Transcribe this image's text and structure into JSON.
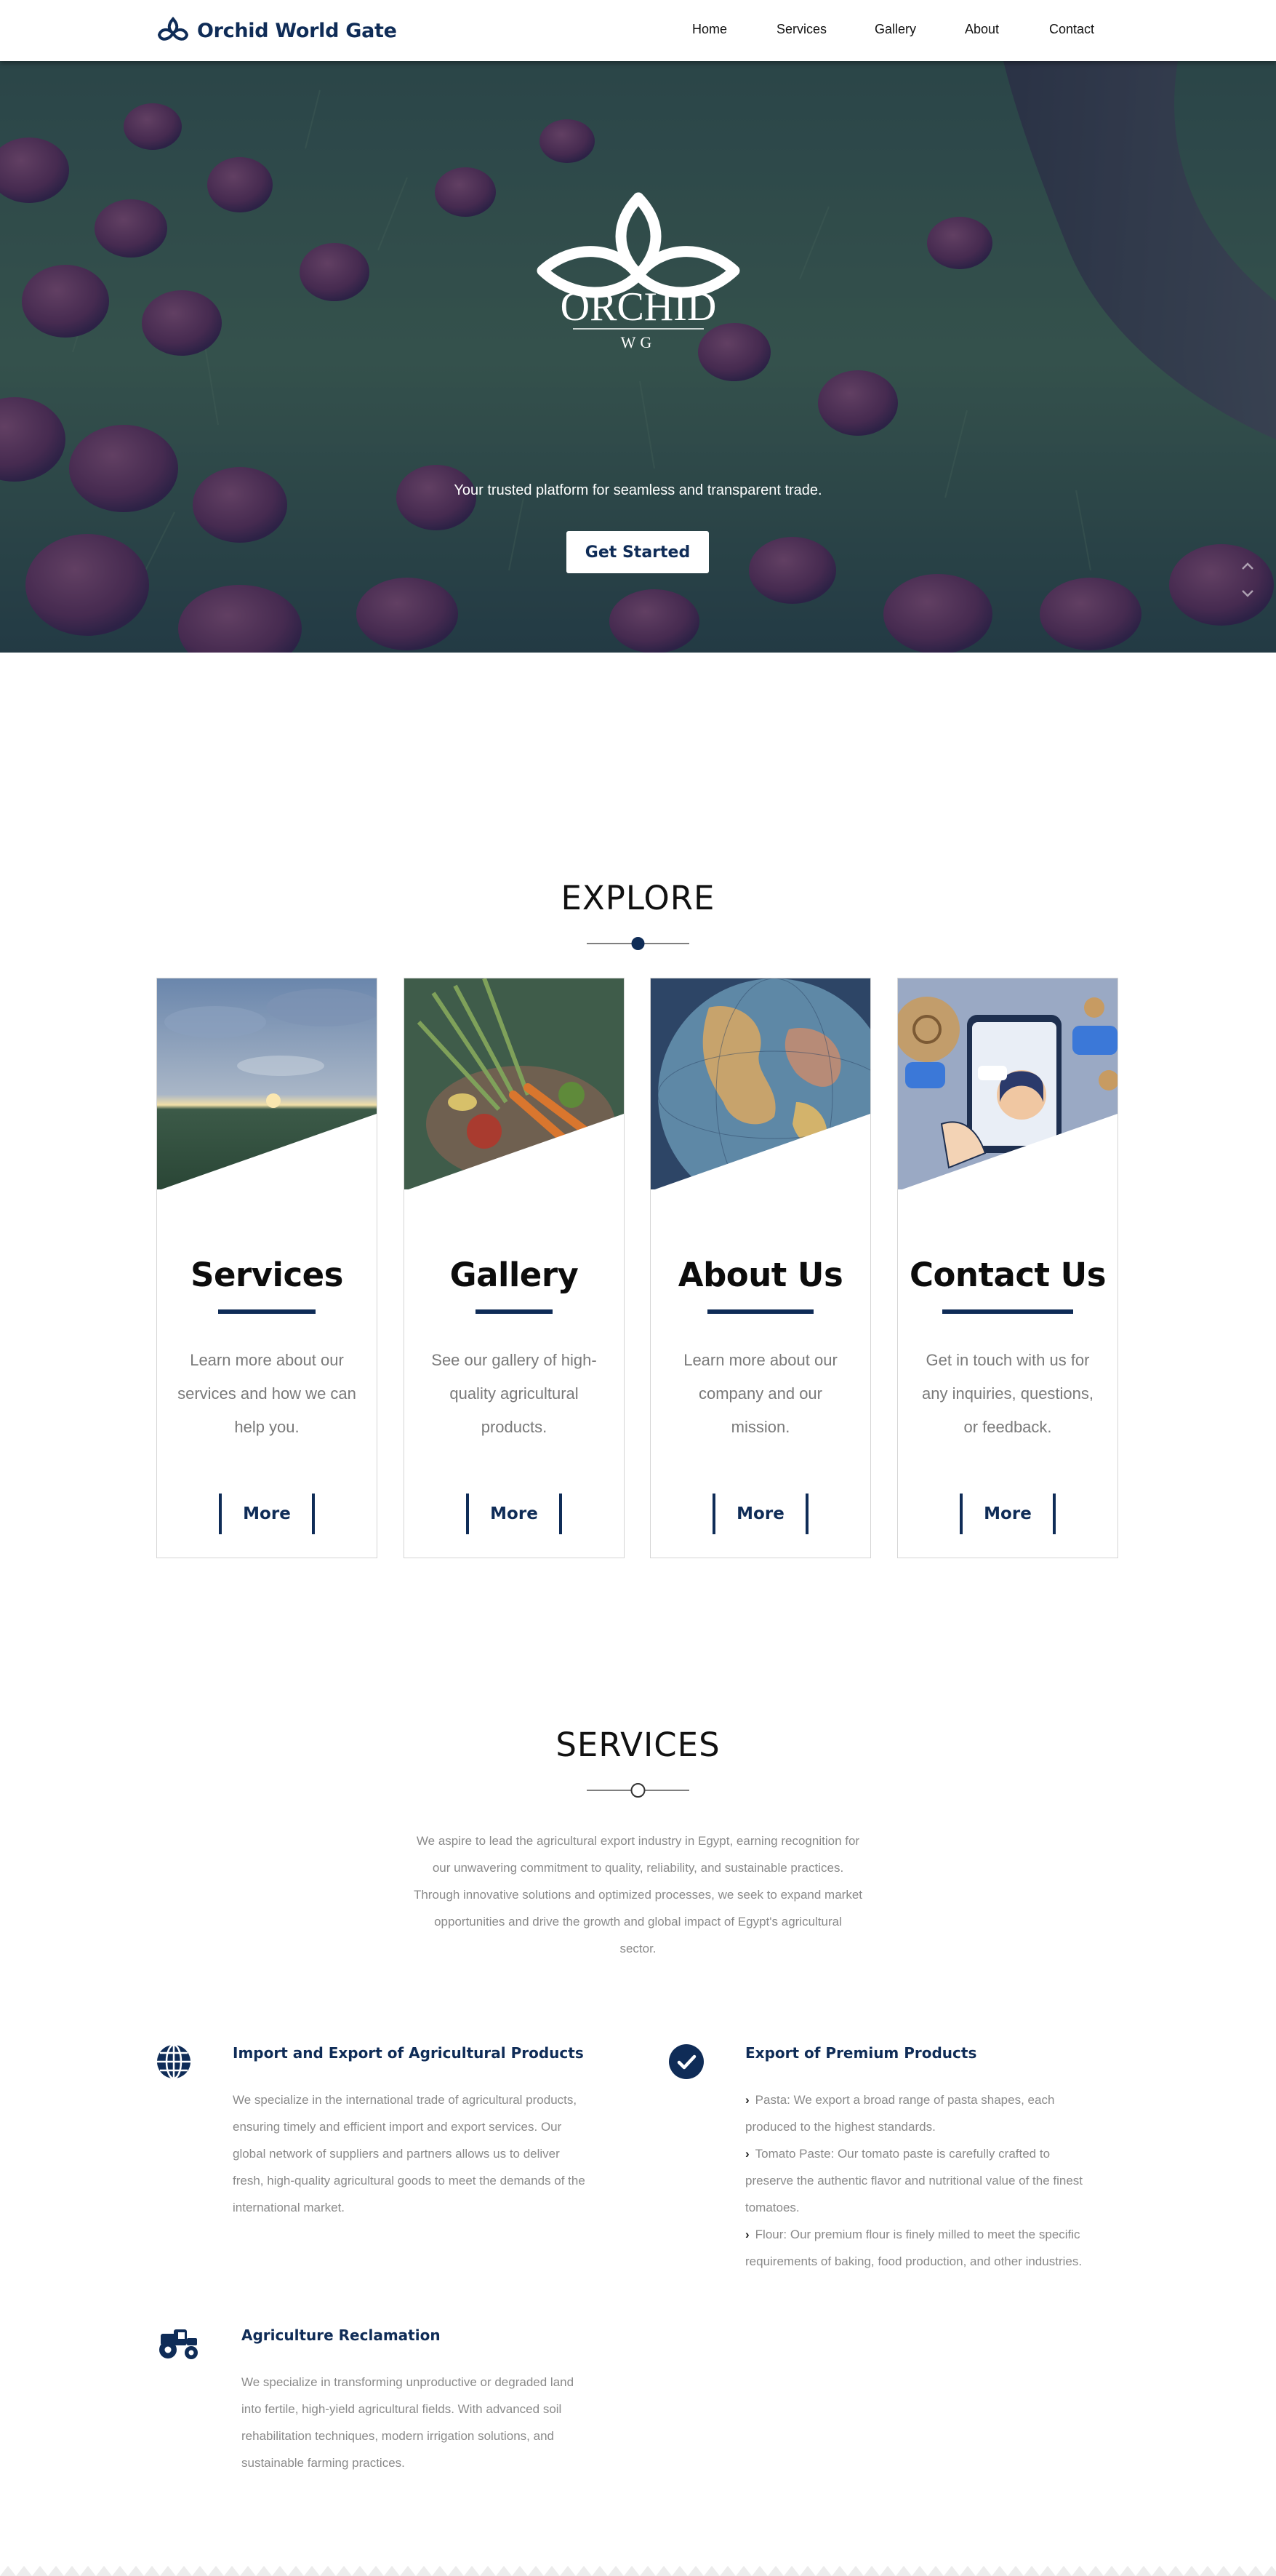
{
  "navbar": {
    "brand": "Orchid World Gate",
    "links": [
      "Home",
      "Services",
      "Gallery",
      "About",
      "Contact"
    ]
  },
  "hero": {
    "logo_word": "ORCHID",
    "logo_sub": "WG",
    "tagline": "Your trusted platform for seamless and transparent trade.",
    "cta": "Get Started",
    "scroll_up_icon": "chevron-up-icon",
    "scroll_down_icon": "chevron-down-icon"
  },
  "explore": {
    "title": "EXPLORE",
    "cards": [
      {
        "title": "Services",
        "desc_lines": [
          "Learn more about our",
          "services and how we can",
          "help you."
        ],
        "button": "More",
        "image": "wheat-field-sunset"
      },
      {
        "title": "Gallery",
        "desc_lines": [
          "See our gallery of high-",
          "quality agricultural",
          "products."
        ],
        "button": "More",
        "image": "vegetable-basket"
      },
      {
        "title": "About Us",
        "desc_lines": [
          "Learn more about our",
          "company and our",
          "mission."
        ],
        "button": "More",
        "image": "globe-map"
      },
      {
        "title": "Contact Us",
        "desc_lines": [
          "Get in touch with us for",
          "any inquiries, questions,",
          "or feedback."
        ],
        "button": "More",
        "image": "phone-chat-illustration"
      }
    ]
  },
  "services": {
    "title": "SERVICES",
    "intro_lines": [
      "We aspire to lead the agricultural export industry in Egypt, earning recognition for",
      "our unwavering commitment to quality, reliability, and sustainable practices.",
      "Through innovative solutions and optimized processes, we seek to expand market",
      "opportunities and drive the growth and global impact of Egypt's agricultural",
      "sector."
    ],
    "items": [
      {
        "icon": "globe-icon",
        "heading": "Import and Export of Agricultural Products",
        "lines": [
          "We specialize in the international trade of agricultural products,",
          "ensuring timely and efficient import and export services. Our",
          "global network of suppliers and partners allows us to deliver",
          "fresh, high-quality agricultural goods to meet the demands of the",
          "international market."
        ]
      },
      {
        "icon": "check-circle-icon",
        "heading": "Export of Premium Products",
        "bullets": [
          {
            "first": "Pasta: We export a broad range of pasta shapes, each",
            "rest": [
              "produced to the highest standards."
            ]
          },
          {
            "first": "Tomato Paste: Our tomato paste is carefully crafted to",
            "rest": [
              "preserve the authentic flavor and nutritional value of the finest",
              "tomatoes."
            ]
          },
          {
            "first": "Flour: Our premium flour is finely milled to meet the specific",
            "rest": [
              "requirements of baking, food production, and other industries."
            ]
          }
        ]
      },
      {
        "icon": "tractor-icon",
        "heading": "Agriculture Reclamation",
        "lines": [
          "We specialize in transforming unproductive or degraded land",
          "into fertile, high-yield agricultural fields. With advanced soil",
          "rehabilitation techniques, modern irrigation solutions, and",
          "sustainable farming practices."
        ]
      }
    ]
  },
  "colors": {
    "brand_navy": "#0f2c57",
    "hero_overlay": "#162c5c",
    "muted_text": "#8a8a8a"
  }
}
